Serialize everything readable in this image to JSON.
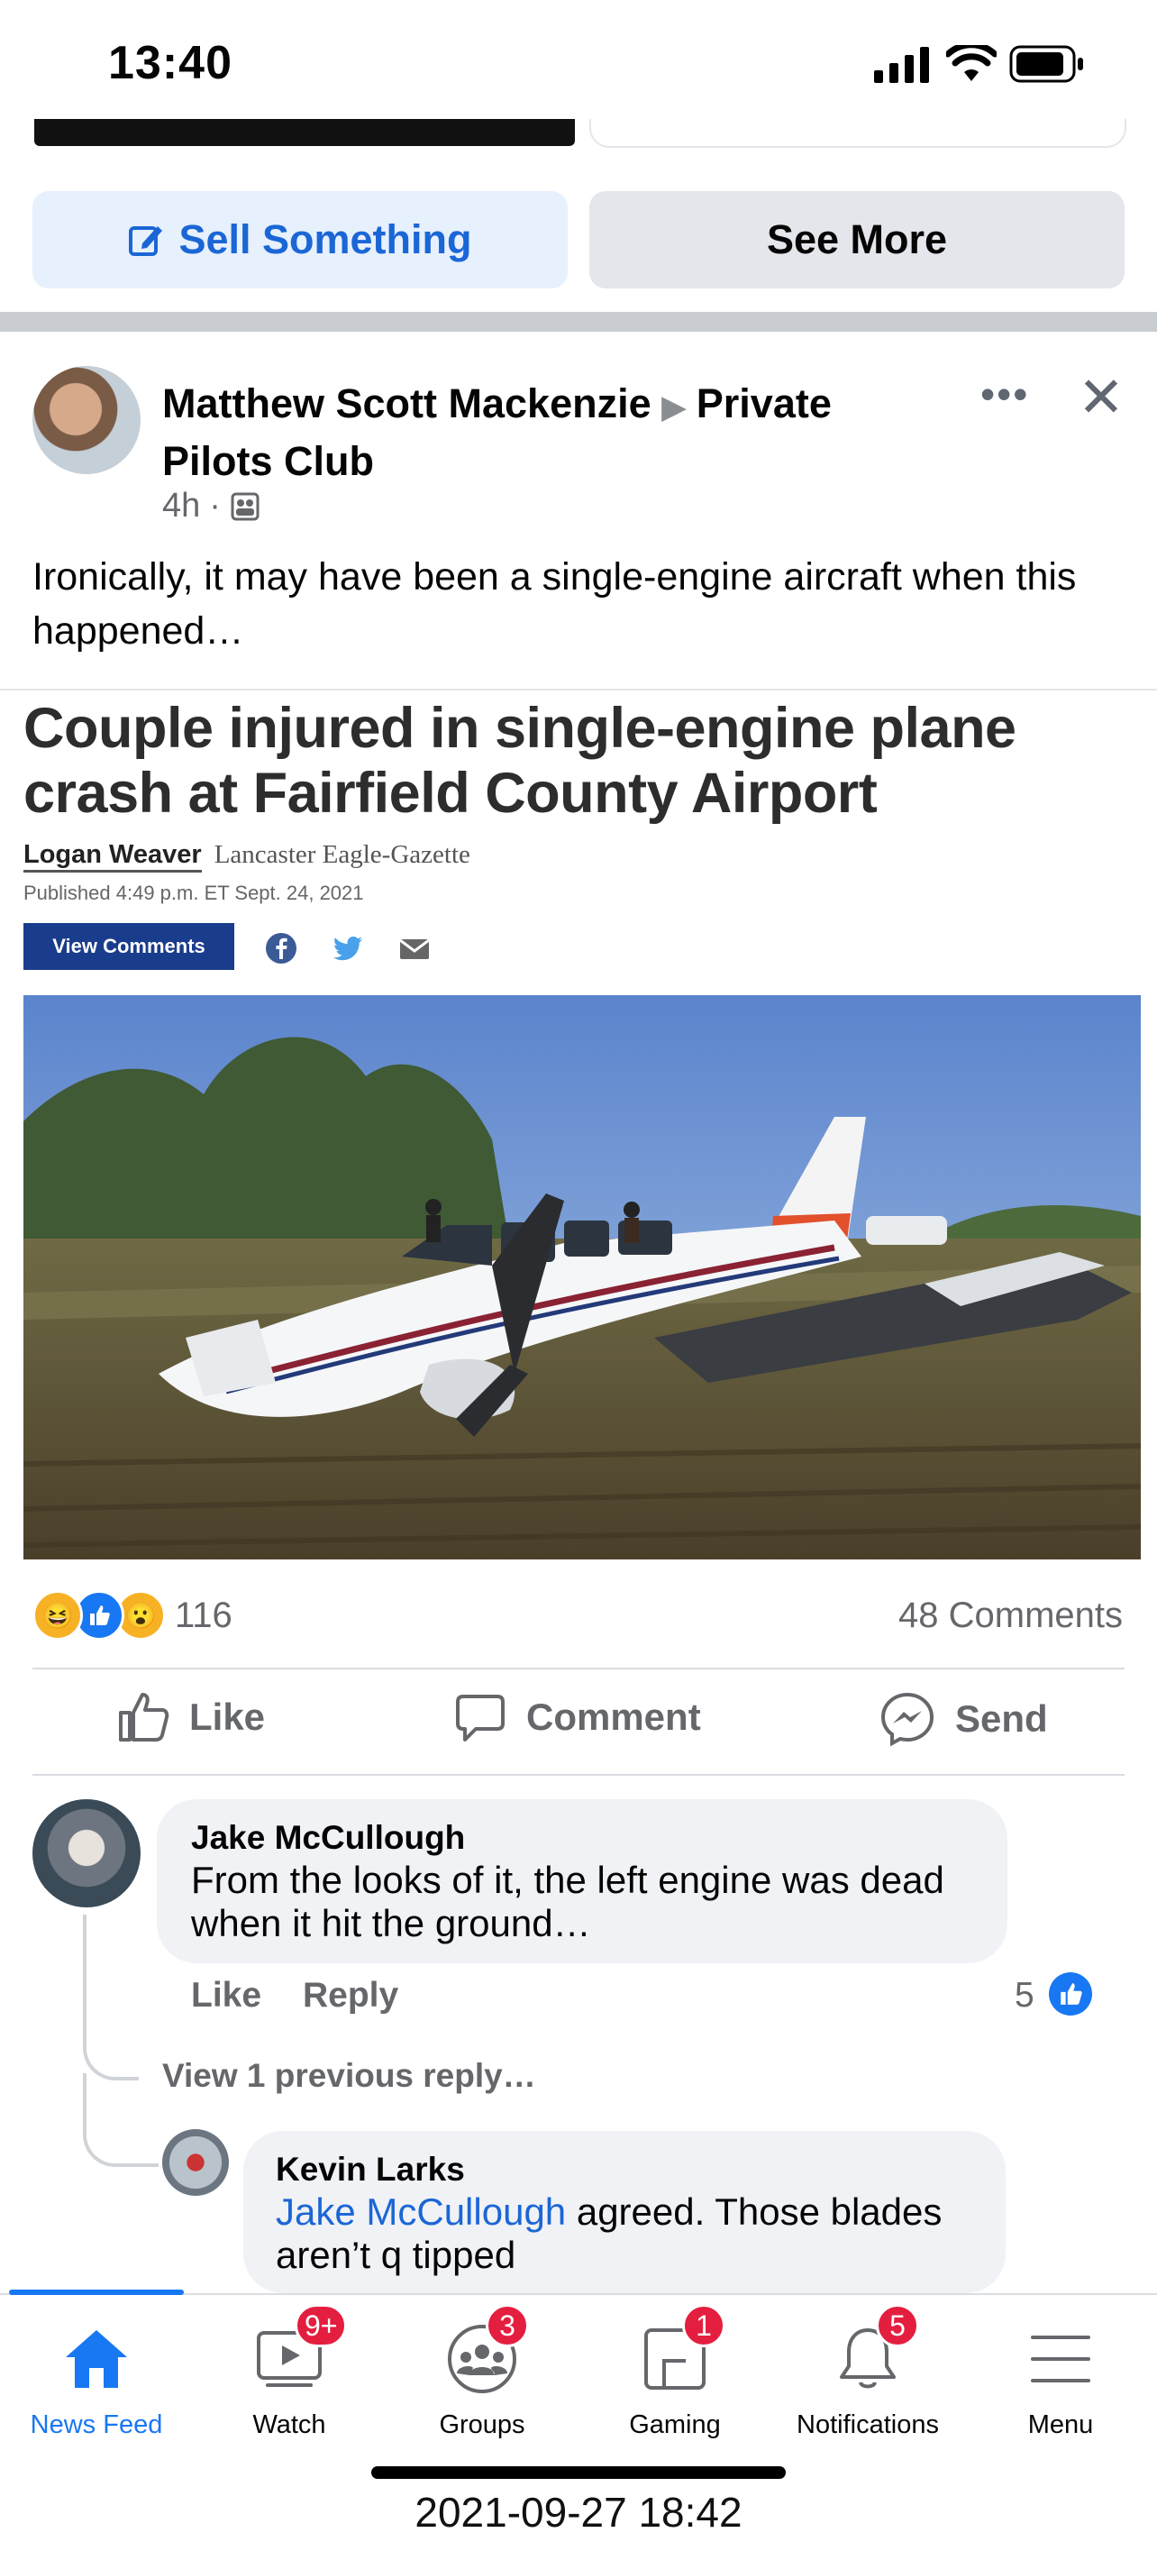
{
  "status_bar": {
    "time": "13:40"
  },
  "marketplace": {
    "sell_label": "Sell Something",
    "more_label": "See More"
  },
  "post": {
    "author": "Matthew Scott Mackenzie",
    "group": "Private Pilots Club",
    "time": "4h",
    "text": "Ironically, it may have been a single-engine aircraft when this happened…"
  },
  "article": {
    "headline": "Couple injured in single-engine plane crash at Fairfield County Airport",
    "author": "Logan Weaver",
    "source": "Lancaster Eagle-Gazette",
    "published": "Published 4:49 p.m. ET Sept. 24, 2021",
    "view_comments": "View Comments"
  },
  "engagement": {
    "reaction_count": "116",
    "comment_count": "48 Comments"
  },
  "actions": {
    "like": "Like",
    "comment": "Comment",
    "send": "Send"
  },
  "comments": [
    {
      "name": "Jake McCullough",
      "text": "From the looks of it, the left engine was dead when it hit the ground…",
      "like": "Like",
      "reply": "Reply",
      "likes": "5"
    }
  ],
  "view_previous": "View 1 previous reply…",
  "reply": {
    "name": "Kevin Larks",
    "mention": "Jake McCullough",
    "text": " agreed.  Those blades aren’t q tipped"
  },
  "nav": [
    {
      "label": "News Feed",
      "badge": ""
    },
    {
      "label": "Watch",
      "badge": "9+"
    },
    {
      "label": "Groups",
      "badge": "3"
    },
    {
      "label": "Gaming",
      "badge": "1"
    },
    {
      "label": "Notifications",
      "badge": "5"
    },
    {
      "label": "Menu",
      "badge": ""
    }
  ],
  "screenshot_timestamp": "2021-09-27 18:42",
  "colors": {
    "accent": "#1877f2",
    "badge": "#e41e3f",
    "article_button": "#1a3c8c"
  },
  "icons": [
    "signal-icon",
    "wifi-icon",
    "battery-icon",
    "edit-icon",
    "privacy-icon",
    "facebook-icon",
    "twitter-icon",
    "mail-icon",
    "like-icon",
    "comment-icon",
    "messenger-icon",
    "home-icon",
    "watch-icon",
    "groups-icon",
    "gaming-icon",
    "bell-icon",
    "menu-icon"
  ]
}
